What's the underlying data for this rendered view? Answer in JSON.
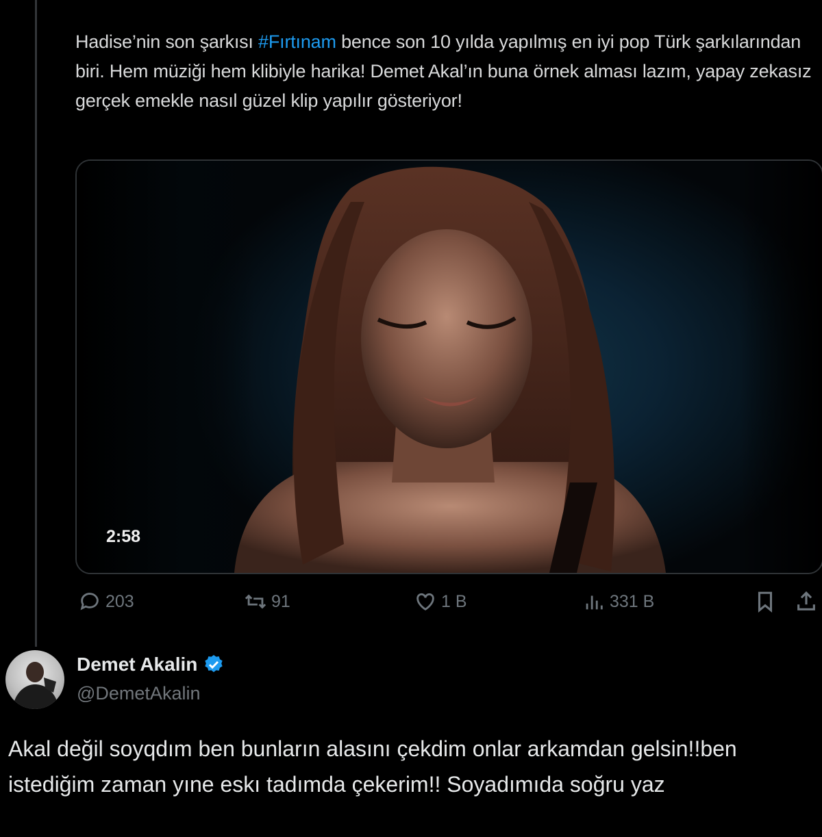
{
  "tweet": {
    "text_before": "Hadise’nin son şarkısı ",
    "hashtag": "#Fırtınam",
    "text_after": " bence son 10 yılda yapılmış en iyi pop Türk şarkılarından biri. Hem müziği hem klibiyle harika! Demet Akal’ın buna örnek alması lazım, yapay zekasız gerçek emekle nasıl güzel klip yapılır gösteriyor!",
    "video_duration": "2:58",
    "stats": {
      "replies": "203",
      "retweets": "91",
      "likes": "1 B",
      "views": "331 B"
    }
  },
  "reply": {
    "author_name": "Demet Akalin",
    "author_handle": "@DemetAkalin",
    "text": "Akal değil soyqdım ben bunların alasını çekdim onlar arkamdan gelsin!!ben istediğim zaman yıne eskı tadımda çekerim!! Soyadımıda soğru yaz"
  },
  "colors": {
    "background": "#000000",
    "hashtag": "#1d9bf0",
    "verified_badge": "#1d9bf0",
    "muted_text": "#71767b"
  },
  "icons": [
    "reply-icon",
    "retweet-icon",
    "like-icon",
    "views-icon",
    "bookmark-icon",
    "share-icon",
    "verified-badge-icon"
  ]
}
